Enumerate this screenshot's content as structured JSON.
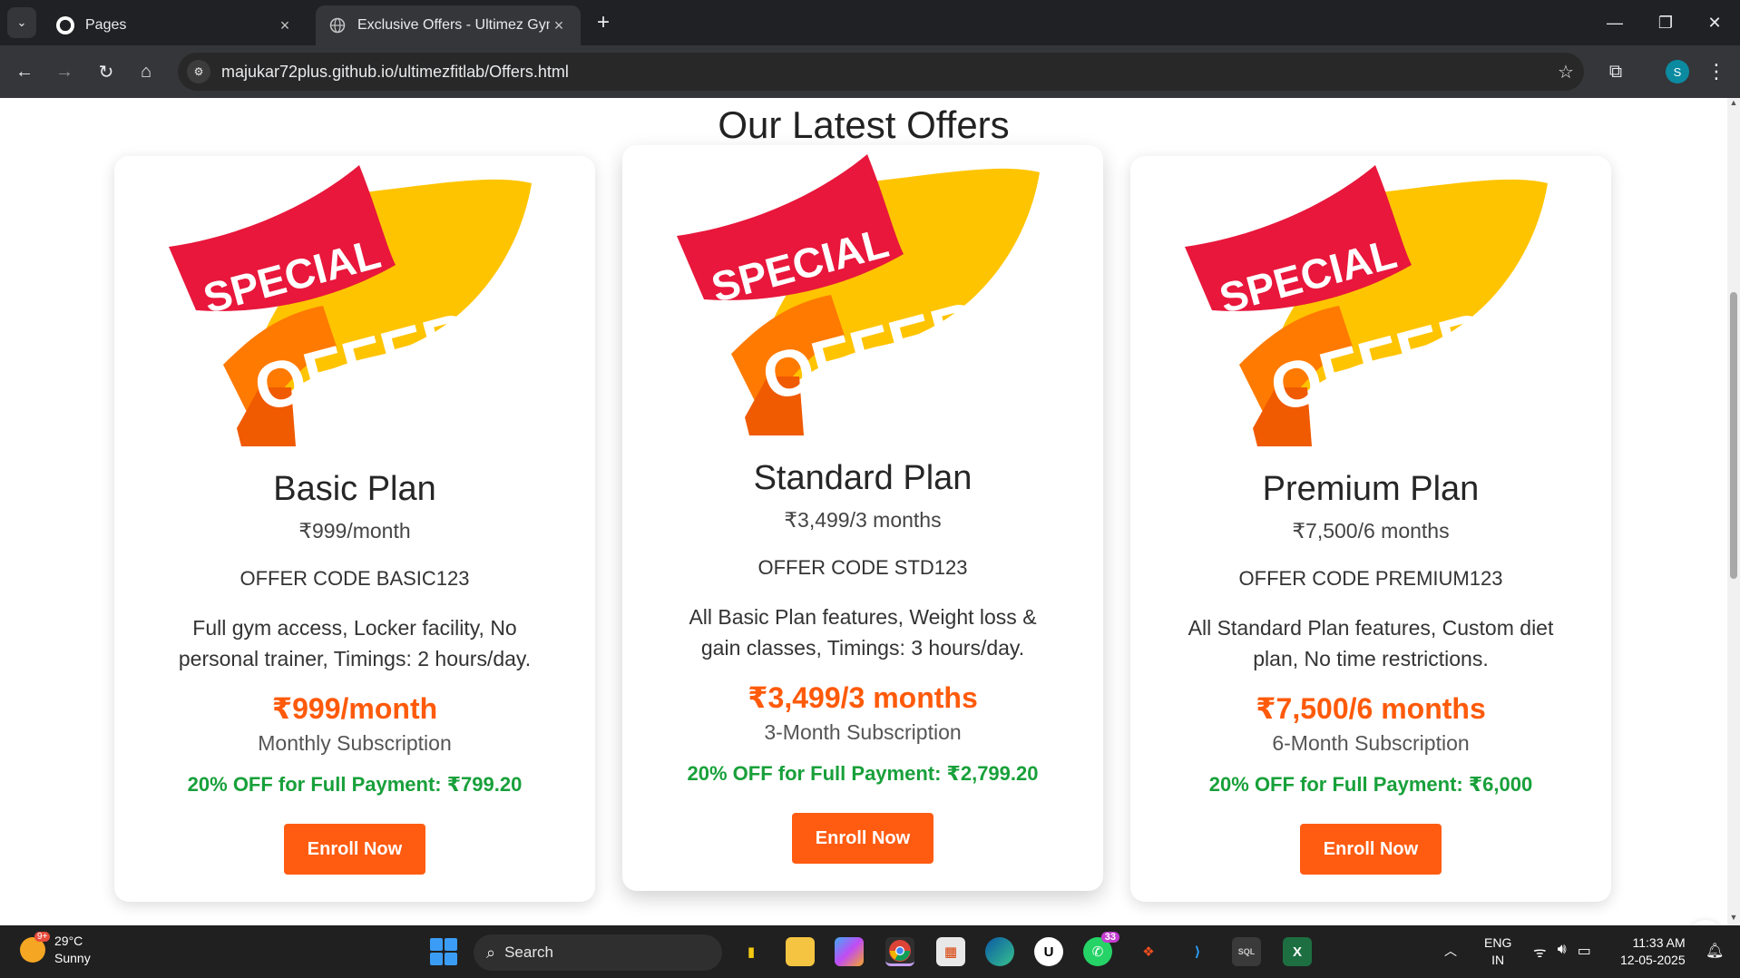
{
  "browser": {
    "tabs": [
      {
        "title": "Pages",
        "active": false
      },
      {
        "title": "Exclusive Offers - Ultimez Gym",
        "active": true
      }
    ],
    "url": "majukar72plus.github.io/ultimezfitlab/Offers.html",
    "profile_initial": "S"
  },
  "page": {
    "heading": "Our Latest Offers",
    "badge": {
      "line1": "SPECIAL",
      "line2": "OFFER"
    },
    "plans": [
      {
        "name": "Basic Plan",
        "price": "₹999/month",
        "offer_code": "OFFER CODE BASIC123",
        "description": "Full gym access, Locker facility, No personal trainer, Timings: 2 hours/day.",
        "big_price": "₹999/month",
        "subscription": "Monthly Subscription",
        "discount": "20% OFF for Full Payment: ₹799.20",
        "button": "Enroll Now"
      },
      {
        "name": "Standard Plan",
        "price": "₹3,499/3 months",
        "offer_code": "OFFER CODE STD123",
        "description": "All Basic Plan features, Weight loss & gain classes, Timings: 3 hours/day.",
        "big_price": "₹3,499/3 months",
        "subscription": "3-Month Subscription",
        "discount": "20% OFF for Full Payment: ₹2,799.20",
        "button": "Enroll Now"
      },
      {
        "name": "Premium Plan",
        "price": "₹7,500/6 months",
        "offer_code": "OFFER CODE PREMIUM123",
        "description": "All Standard Plan features, Custom diet plan, No time restrictions.",
        "big_price": "₹7,500/6 months",
        "subscription": "6-Month Subscription",
        "discount": "20% OFF for Full Payment: ₹6,000",
        "button": "Enroll Now"
      }
    ]
  },
  "taskbar": {
    "weather_temp": "29°C",
    "weather_desc": "Sunny",
    "weather_badge": "9+",
    "search_label": "Search",
    "whatsapp_badge": "33",
    "lang_line1": "ENG",
    "lang_line2": "IN",
    "time": "11:33 AM",
    "date": "12-05-2025"
  },
  "colors": {
    "accent_orange": "#ff5c12",
    "discount_green": "#18a03a",
    "badge_red": "#e8173b",
    "badge_yellow": "#ffcf00"
  }
}
